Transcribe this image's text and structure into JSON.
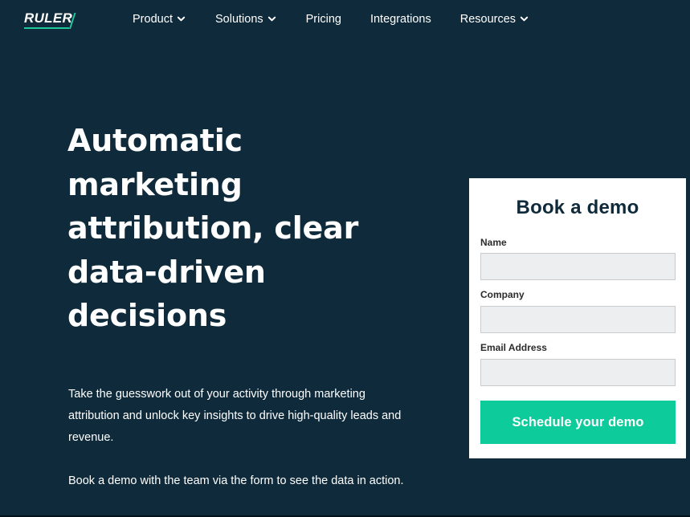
{
  "brand": {
    "logo_text": "RULER",
    "accent_color": "#1ec99a",
    "background_color": "#0f2a3a"
  },
  "nav": {
    "items": [
      {
        "label": "Product",
        "has_dropdown": true,
        "icon": "chevron-down-icon"
      },
      {
        "label": "Solutions",
        "has_dropdown": true,
        "icon": "chevron-down-icon"
      },
      {
        "label": "Pricing",
        "has_dropdown": false
      },
      {
        "label": "Integrations",
        "has_dropdown": false
      },
      {
        "label": "Resources",
        "has_dropdown": true,
        "icon": "chevron-down-icon"
      }
    ]
  },
  "hero": {
    "headline_lines": [
      "Automatic",
      "marketing",
      "attribution, clear",
      "data-driven",
      "decisions"
    ],
    "intro_paragraph": "Take the guesswork out of your activity through marketing attribution and unlock key insights to drive high-quality leads and revenue.",
    "cta_paragraph": "Book a demo with the team via the form to see the data in action."
  },
  "demo_form": {
    "title": "Book a demo",
    "fields": [
      {
        "label": "Name",
        "value": "",
        "placeholder": ""
      },
      {
        "label": "Company",
        "value": "",
        "placeholder": ""
      },
      {
        "label": "Email Address",
        "value": "",
        "placeholder": ""
      }
    ],
    "submit_label": "Schedule your demo",
    "submit_color": "#0ecb9b"
  }
}
